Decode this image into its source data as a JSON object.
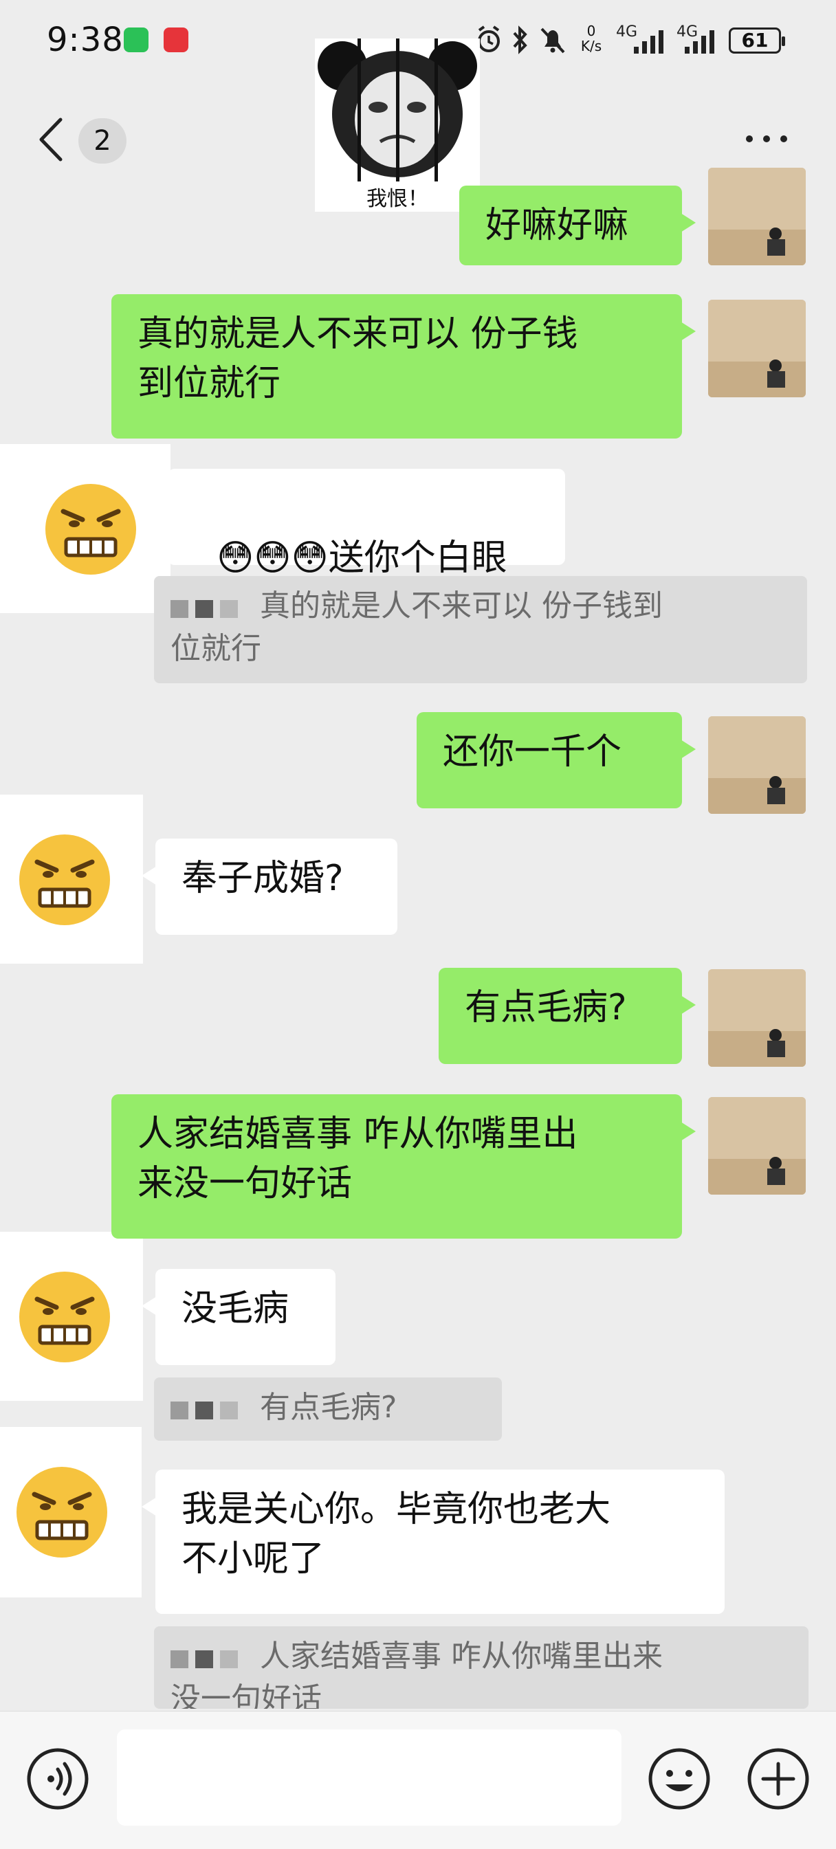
{
  "status_bar": {
    "time": "9:38",
    "network_speed_value": "0",
    "network_speed_unit": "K/s",
    "signal_1": "4G",
    "signal_2": "4G",
    "battery": "61"
  },
  "navbar": {
    "unread_count": "2"
  },
  "sticker": {
    "caption": "我恨！"
  },
  "messages": [
    {
      "type": "sent",
      "text": "好嘛好嘛"
    },
    {
      "type": "sent",
      "text": "真的就是人不来可以 份子钱\n到位就行"
    },
    {
      "type": "received",
      "text": "送你个白眼",
      "emoji_prefix": "😳😳😳"
    },
    {
      "type": "quote",
      "text": "真的就是人不来可以 份子钱到\n位就行"
    },
    {
      "type": "sent",
      "text": "还你一千个"
    },
    {
      "type": "received",
      "text": "奉子成婚?"
    },
    {
      "type": "sent",
      "text": "有点毛病?"
    },
    {
      "type": "sent",
      "text": "人家结婚喜事 咋从你嘴里出\n来没一句好话"
    },
    {
      "type": "received",
      "text": "没毛病"
    },
    {
      "type": "quote",
      "text": "有点毛病?"
    },
    {
      "type": "received",
      "text": "我是关心你。毕竟你也老大\n不小呢了"
    },
    {
      "type": "quote",
      "text": "人家结婚喜事 咋从你嘴里出来\n没一句好话"
    }
  ],
  "icons": {
    "back": "chevron-left-icon",
    "more": "more-dots-icon",
    "voice": "voice-icon",
    "emoji": "emoji-icon",
    "plus": "plus-icon"
  },
  "colors": {
    "background": "#ededed",
    "sent_bubble": "#95ec69",
    "received_bubble": "#ffffff",
    "quote_bubble": "#dcdcdc"
  }
}
